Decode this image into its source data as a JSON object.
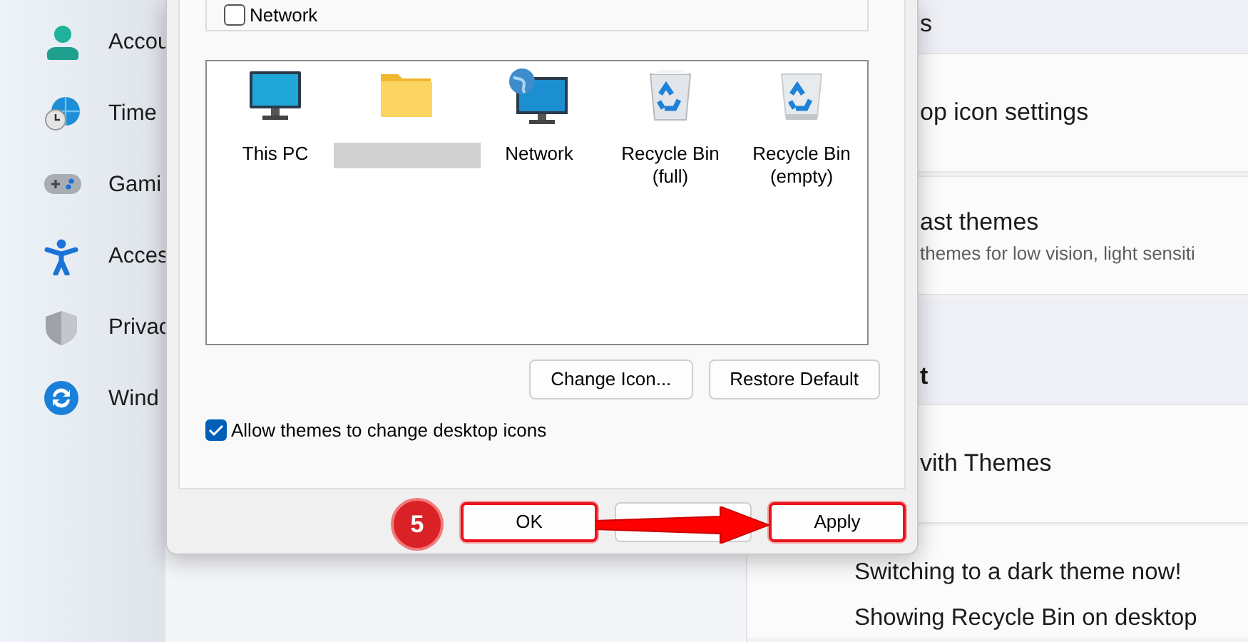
{
  "sidebar": {
    "items": [
      {
        "label": "Accou"
      },
      {
        "label": "Time"
      },
      {
        "label": "Gami"
      },
      {
        "label": "Acces"
      },
      {
        "label": "Privac"
      },
      {
        "label": "Wind"
      }
    ]
  },
  "settings_panel": {
    "rows": [
      {
        "kind": "header",
        "title": "s"
      },
      {
        "kind": "card",
        "title": "op icon settings"
      },
      {
        "kind": "card",
        "title": "ast themes",
        "subtitle": "themes for low vision, light sensiti"
      },
      {
        "kind": "header",
        "title": "t"
      },
      {
        "kind": "card",
        "title": "vith Themes"
      },
      {
        "kind": "link",
        "title": "Switching to a dark theme now!"
      },
      {
        "kind": "link",
        "title": "Showing Recycle Bin on desktop"
      }
    ]
  },
  "dialog": {
    "desktop_icon_checkboxes": [
      {
        "label": "Network",
        "checked": false
      }
    ],
    "icons": [
      {
        "kind": "monitor",
        "label": "This PC",
        "redacted": false
      },
      {
        "kind": "folder",
        "redacted": true
      },
      {
        "kind": "network",
        "label": "Network",
        "redacted": false
      },
      {
        "kind": "bin-full",
        "label": "Recycle Bin (full)",
        "redacted": false
      },
      {
        "kind": "bin-empty",
        "label": "Recycle Bin (empty)",
        "redacted": false
      }
    ],
    "icon_buttons": [
      "Change Icon...",
      "Restore Default"
    ],
    "allow_themes": {
      "label": "Allow themes to change desktop icons",
      "checked": true
    },
    "buttons": [
      {
        "label": "OK",
        "highlighted": true
      },
      {
        "highlighted": false
      },
      {
        "label": "Apply",
        "highlighted": true
      }
    ]
  },
  "annotation": {
    "step": "5"
  }
}
